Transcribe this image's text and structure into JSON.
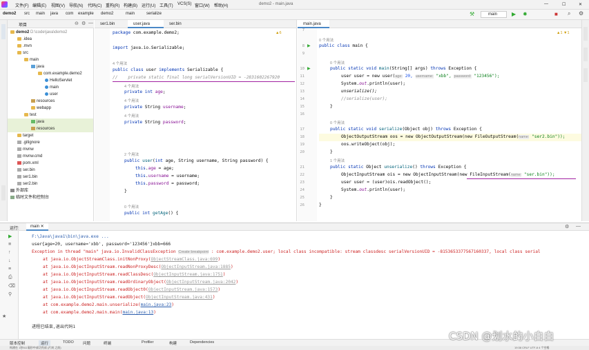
{
  "titlebar": {
    "menus": [
      "文件(F)",
      "编辑(E)",
      "视图(V)",
      "导航(N)",
      "代码(C)",
      "重构(R)",
      "构建(B)",
      "运行(U)",
      "工具(T)",
      "VCS(S)",
      "窗口(W)",
      "帮助(H)"
    ],
    "title": "demo2 - main.java"
  },
  "breadcrumb": [
    "demo2",
    "src",
    "main",
    "java",
    "com",
    "example",
    "demo2",
    "main",
    "serialize"
  ],
  "toolbar": {
    "run_config": "main"
  },
  "project": {
    "header": "项目",
    "root": "demo2",
    "root_path": "D:\\code\\java\\demo2",
    "items": [
      ".idea",
      ".mvn",
      "src",
      "main",
      "java",
      "com.example.demo2",
      "HelloServlet",
      "main",
      "user",
      "resources",
      "webapp",
      "test",
      "java",
      "resources",
      "target",
      ".gitignore",
      "mvnw",
      "mvnw.cmd",
      "pom.xml",
      "ser.bin",
      "ser1.bin",
      "ser2.bin",
      "外部库",
      "临时文件和控制台"
    ]
  },
  "left_editor": {
    "tabs": [
      "ser1.bin",
      "user.java",
      "ser.bin"
    ],
    "warnings": "▲6",
    "usage_hints": [
      "4 个用法",
      "4 个用法",
      "4 个用法",
      "4 个用法",
      "2 个用法",
      "0 个用法"
    ],
    "lines": {
      "pkg": "package com.example.demo2;",
      "imp": "import java.io.Serializable;",
      "cls": "public class user implements Serializable {",
      "cmt": "//    private static final long serialVersionUID = -2831602267920",
      "f1": "private int age;",
      "f2": "private String username;",
      "f3": "private String password;",
      "ctor": "public user(int age, String username, String password) {",
      "a1": "this.age = age;",
      "a2": "this.username = username;",
      "a3": "this.password = password;",
      "close": "}",
      "getter": "public int getAge() {"
    }
  },
  "right_editor": {
    "tabs": [
      "main.java"
    ],
    "warnings": "▲1 ▼1",
    "line_numbers": [
      "7",
      "8",
      "9",
      "10",
      "11",
      "12",
      "13",
      "14",
      "15",
      "16",
      "17",
      "18",
      "19",
      "20",
      "21",
      "22",
      "23",
      "24",
      "25",
      "26"
    ],
    "usage_hints": [
      "0 个用法",
      "0 个用法",
      "0 个用法",
      "1 个用法"
    ],
    "param_hints": [
      "age:",
      "username:",
      "password:",
      "name:",
      "name:"
    ],
    "lines": {
      "cls": "public class main {",
      "main_sig": "public static void main(String[] args) throws Exception {",
      "new_user_a": "user user = new user(",
      "new_user_b": "20,",
      "new_user_c": "\"xbb\",",
      "new_user_d": "\"123456\");",
      "println": "System.out.println(user);",
      "unser": "unserialize();",
      "ser_cmt": "//serialize(user);",
      "close": "}",
      "ser_sig": "public static void serialize(Object obj) throws Exception {",
      "oos_a": "ObjectOutputStream oos = new ObjectOutputStream(new FileOutputStream(",
      "oos_b": "\"ser2.bin\"));",
      "write": "oos.writeObject(obj);",
      "unser_sig": "public static Object unserialize() throws Exception {",
      "ois_a": "ObjectInputStream ois = new ObjectInputStream(new FileInputStream(",
      "ois_b": "\"ser.bin\"));",
      "read": "user user = (user)ois.readObject();",
      "println2": "System.out.println(user);"
    }
  },
  "run": {
    "label": "运行:",
    "config_tab": "main",
    "cmd": "F:\\Java\\java1\\bin\\java.exe ...",
    "out1": "user{age=20, username='xbb', password='123456'}xbb=666",
    "err_head": "Exception in thread \"main\" java.io.InvalidClassException",
    "err_hint": "Create breakpoint",
    "err_tail": " : com.example.demo2.user; local class incompatible: stream classdesc serialVersionUID = -8153653377567160337, local class serial",
    "trace": [
      {
        "at": "at java.io.ObjectStreamClass.initNonProxy(",
        "src": "ObjectStreamClass.java:699",
        "end": ")"
      },
      {
        "at": "at java.io.ObjectInputStream.readNonProxyDesc(",
        "src": "ObjectInputStream.java:1885",
        "end": ")"
      },
      {
        "at": "at java.io.ObjectInputStream.readClassDesc(",
        "src": "ObjectInputStream.java:1751",
        "end": ")"
      },
      {
        "at": "at java.io.ObjectInputStream.readOrdinaryObject(",
        "src": "ObjectInputStream.java:2042",
        "end": ")"
      },
      {
        "at": "at java.io.ObjectInputStream.readObject0(",
        "src": "ObjectInputStream.java:1573",
        "end": ")"
      },
      {
        "at": "at java.io.ObjectInputStream.readObject(",
        "src": "ObjectInputStream.java:431",
        "end": ")"
      },
      {
        "at": "at com.example.demo2.main.unserialize(",
        "src": "main.java:23",
        "end": ")"
      },
      {
        "at": "at com.example.demo2.main.main(",
        "src": "main.java:13",
        "end": ")"
      }
    ],
    "exit": "进程已结束,退出代码1"
  },
  "bottom_tabs": [
    "版本控制",
    "运行",
    "TODO",
    "问题",
    "终端",
    "Profiler",
    "构建",
    "Dependencies"
  ],
  "status": {
    "text": "构建在 1秒511毫秒中成功完成 (片刻 之前)",
    "right": "19:38  CRLF  UTF-8  4 个空格"
  },
  "watermark": "CSDN @划水的小白白",
  "colors": {
    "accent": "#4a88c7",
    "error": "#cc2222",
    "keyword": "#0033b3",
    "string": "#067d17"
  }
}
